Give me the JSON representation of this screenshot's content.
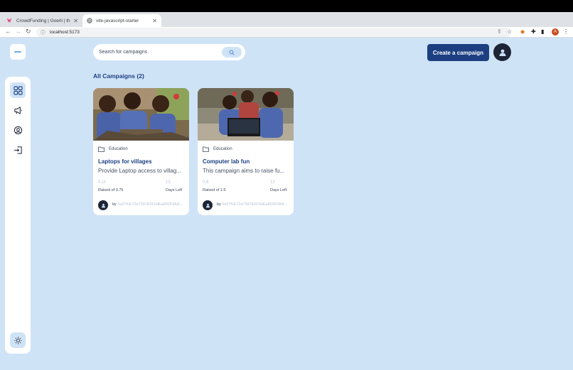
{
  "browser": {
    "tabs": [
      {
        "title": "CrowdFunding | Goerli | thirdw",
        "active": false,
        "favicon": "thirdweb-icon"
      },
      {
        "title": "vite-javascript-starter",
        "active": true,
        "favicon": "globe-icon"
      }
    ],
    "new_tab": "+",
    "url": "localhost:5173",
    "profile_initial": "A"
  },
  "search": {
    "placeholder": "Search for campaigns"
  },
  "header": {
    "create_label": "Create a campaign"
  },
  "section_title": "All Campaigns (2)",
  "sidebar": {
    "items": [
      {
        "icon": "dashboard-icon",
        "active": true
      },
      {
        "icon": "megaphone-icon",
        "active": false
      },
      {
        "icon": "profile-icon",
        "active": false
      },
      {
        "icon": "logout-icon",
        "active": false
      }
    ],
    "theme_icon": "sun-icon"
  },
  "campaigns": [
    {
      "category": "Education",
      "title": "Laptops for villages",
      "description": "Provide Laptop access to villag...",
      "raised": "0.11",
      "raised_label": "Raised of 0.75",
      "days": "13",
      "days_label": "Days Left",
      "owner_prefix": "by ",
      "owner": "0x37fcE72a7397E5F0dEa860F9AA..."
    },
    {
      "category": "Education",
      "title": "Computer lab fun",
      "description": "This campaign aims to raise fu...",
      "raised": "0.6",
      "raised_label": "Raised of 1.5",
      "days": "13",
      "days_label": "Days Left",
      "owner_prefix": "by ",
      "owner": "0x37fcE72a7397E5F0dEa860F9AA..."
    }
  ],
  "colors": {
    "background": "#cfe3f7",
    "primary": "#1c3f82",
    "avatar": "#1d2435"
  }
}
